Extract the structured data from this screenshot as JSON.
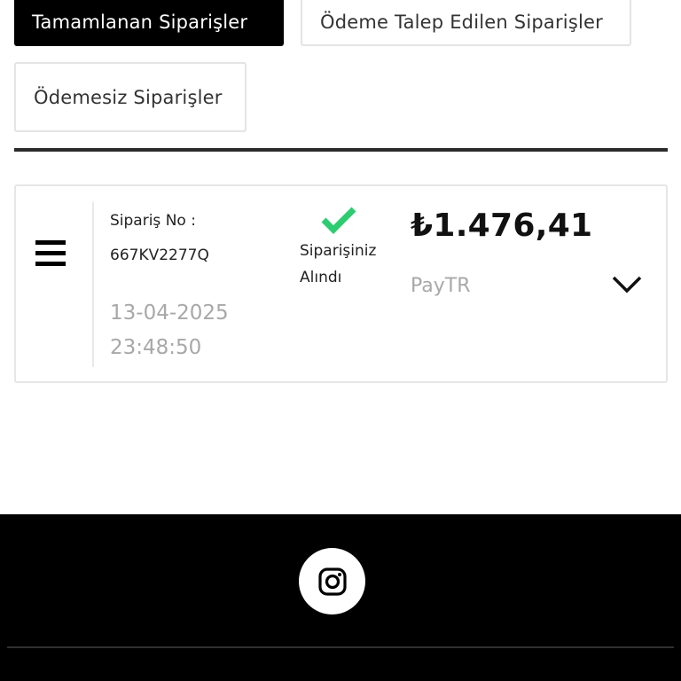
{
  "tabs": {
    "completed": "Tamamlanan Siparişler",
    "payment_requested": "Ödeme Talep Edilen Siparişler",
    "unpaid": "Ödemesiz Siparişler"
  },
  "order": {
    "order_no_label": "Sipariş No :",
    "order_no": "667KV2277Q",
    "date": "13-04-2025",
    "time": "23:48:50",
    "status": "Siparişiniz Alındı",
    "price": "₺1.476,41",
    "payment_method": "PayTR"
  },
  "icons": {
    "menu": "menu-icon",
    "status": "check-icon",
    "expand": "chevron-down-icon",
    "social": "instagram-icon"
  },
  "colors": {
    "status_green": "#2ecc71",
    "active_tab": "#000000",
    "footer": "#000000"
  }
}
